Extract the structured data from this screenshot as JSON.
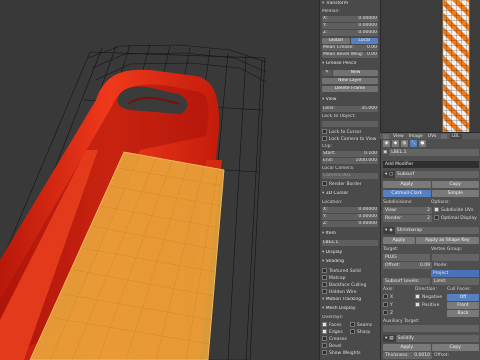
{
  "viewport": {
    "colors": {
      "background": "#393939",
      "wire": "#111111",
      "red": "#e0260c",
      "orange": "#e8a33a"
    }
  },
  "npanel": {
    "transform": "Transform",
    "median": "Median:",
    "x": "X:",
    "x_val": "0.00000",
    "y": "Y:",
    "y_val": "0.00000",
    "z": "Z:",
    "z_val": "0.00000",
    "global": "Global",
    "local": "Local",
    "mean_crease": "Mean Crease:",
    "mean_crease_val": "0.00",
    "mean_bevel": "Mean Bevel Weig:",
    "mean_bevel_val": "0.00",
    "grease_pencil": "Grease Pencil",
    "new": "New",
    "new_layer": "New Layer",
    "delete_frame": "Delete Frame",
    "view": "View",
    "lens": "Lens:",
    "lens_val": "35.000",
    "lock_to_object": "Lock to Object:",
    "lock_to_cursor": "Lock to Cursor",
    "lock_camera": "Lock Camera to View",
    "clip": "Clip:",
    "start": "Start:",
    "start_val": "0.100",
    "end": "End:",
    "end_val": "1000.000",
    "local_camera": "Local Camera:",
    "camera_field": "Camera.001",
    "render_border": "Render Border",
    "cursor_3d": "3D Cursor",
    "location": "Location:",
    "cx": "X:",
    "cx_val": "0.00000",
    "cy": "Y:",
    "cy_val": "0.00000",
    "cz": "Z:",
    "cz_val": "0.00000",
    "item": "Item",
    "item_name": "LBEL.1",
    "display": "Display",
    "shading": "Shading",
    "textured_solid": "Textured Solid",
    "matcap": "Matcap",
    "backface_culling": "Backface Culling",
    "hidden_wire": "Hidden Wire",
    "motion_tracking": "Motion Tracking",
    "mesh_display": "Mesh Display",
    "overlays": "Overlays:",
    "faces": "Faces",
    "seams": "Seams",
    "edges": "Edges",
    "sharp": "Sharp",
    "creases": "Creases",
    "bevel": "Bevel",
    "show_weights": "Show Weights"
  },
  "uv_header": {
    "view": "View",
    "image": "Image",
    "uvs": "UVs",
    "label": "LBL"
  },
  "props": {
    "obj_name": "LBEL.1",
    "add_modifier": "Add Modifier",
    "subsurf_name": "Subsurf",
    "apply": "Apply",
    "copy": "Copy",
    "catmull": "Catmull-Clark",
    "simple": "Simple",
    "subdivisions": "Subdivisions:",
    "options": "Options:",
    "view": "View:",
    "view_val": "2",
    "render": "Render:",
    "render_val": "2",
    "subdivide_uvs": "Subdivide UVs",
    "optimal_display": "Optimal Display",
    "shrinkwrap": "Shrinkwrap",
    "apply_shape": "Apply as Shape Key",
    "target": "Target:",
    "target_val": "PLUG",
    "vertex_group": "Vertex Group:",
    "offset": "Offset:",
    "offset_val": "0.09",
    "mode": "Mode:",
    "project": "Project",
    "subsurf_levels": "Subsurf Levels:",
    "limit": "Limit:",
    "axis": "Axis:",
    "direction": "Direction:",
    "cull_faces": "Cull Faces:",
    "ax_x": "X",
    "ax_y": "Y",
    "ax_z": "Z",
    "negative": "Negative",
    "positive": "Positive",
    "off": "Off",
    "front": "Front",
    "back": "Back",
    "aux_target": "Auxiliary Target:",
    "solidify": "Solidify",
    "thickness": "Thickness:",
    "thickness_val": "0.0010",
    "offset2": "Offset:"
  }
}
